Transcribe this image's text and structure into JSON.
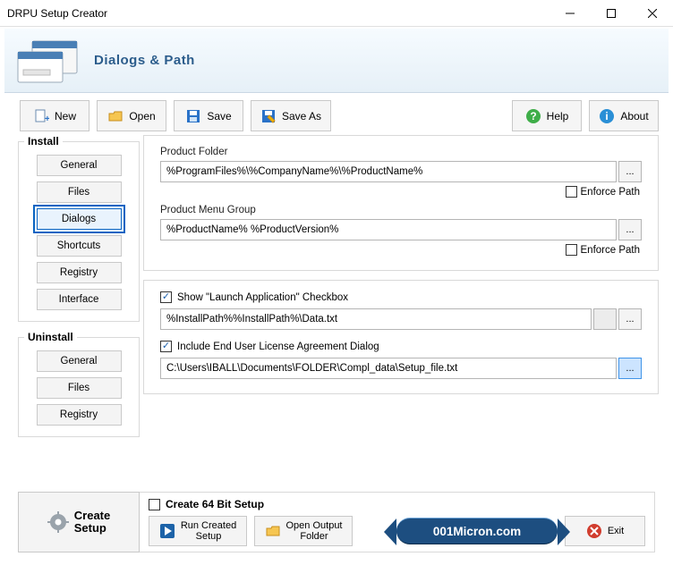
{
  "window": {
    "title": "DRPU Setup Creator"
  },
  "banner": {
    "title": "Dialogs & Path"
  },
  "toolbar": {
    "new": "New",
    "open": "Open",
    "save": "Save",
    "save_as": "Save As",
    "help": "Help",
    "about": "About"
  },
  "sidebar": {
    "install_label": "Install",
    "uninstall_label": "Uninstall",
    "install": [
      "General",
      "Files",
      "Dialogs",
      "Shortcuts",
      "Registry",
      "Interface"
    ],
    "uninstall": [
      "General",
      "Files",
      "Registry"
    ],
    "active": "Dialogs"
  },
  "paths": {
    "product_folder_label": "Product Folder",
    "product_folder_value": "%ProgramFiles%\\%CompanyName%\\%ProductName%",
    "product_menu_label": "Product Menu Group",
    "product_menu_value": "%ProductName% %ProductVersion%",
    "enforce_label": "Enforce Path",
    "browse": "..."
  },
  "options": {
    "launch_label": "Show \"Launch Application\" Checkbox",
    "launch_value": "%InstallPath%%InstallPath%\\Data.txt",
    "eula_label": "Include End User License Agreement Dialog",
    "eula_value": "C:\\Users\\IBALL\\Documents\\FOLDER\\Compl_data\\Setup_file.txt"
  },
  "footer": {
    "create_setup": "Create\nSetup",
    "cb64": "Create 64 Bit Setup",
    "run_created": "Run Created\nSetup",
    "open_output": "Open Output\nFolder",
    "exit": "Exit"
  },
  "brand": "001Micron.com"
}
